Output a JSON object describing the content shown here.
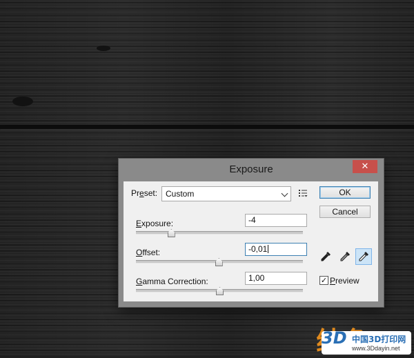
{
  "dialog": {
    "title": "Exposure",
    "close_glyph": "✕",
    "preset": {
      "label_prefix": "Pr",
      "label_underline": "e",
      "label_suffix": "set:",
      "value": "Custom"
    },
    "sliders": [
      {
        "label_underline": "E",
        "label_rest": "xposure:",
        "value": "-4",
        "level": 0.21
      },
      {
        "label_underline": "O",
        "label_rest": "ffset:",
        "value": "-0,01",
        "level": 0.495,
        "focused": true
      },
      {
        "label_underline": "G",
        "label_rest": "amma Correction:",
        "value": "1,00",
        "level": 0.5
      }
    ],
    "buttons": {
      "ok": "OK",
      "cancel": "Cancel"
    },
    "preview": {
      "underline": "P",
      "rest": "review",
      "checked": "✓"
    },
    "icons": [
      "preset-menu-icon",
      "eyedropper-black-icon",
      "eyedropper-gray-icon",
      "eyedropper-white-icon"
    ]
  },
  "watermark": {
    "glyph": "纯色",
    "logo": "3D",
    "name": "中国3D打印网",
    "url": "www.3Ddayin.net"
  }
}
